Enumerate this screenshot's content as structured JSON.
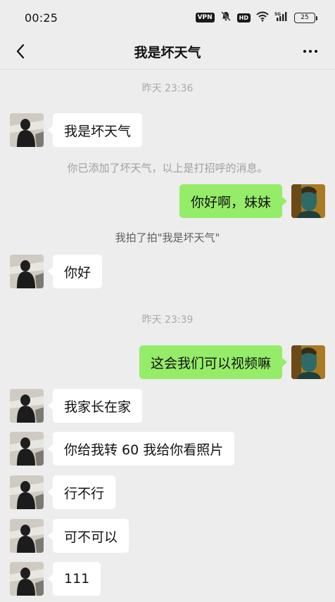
{
  "status_bar": {
    "time": "00:25",
    "vpn": "VPN",
    "hd": "HD",
    "battery": "25"
  },
  "nav": {
    "title": "我是坏天气"
  },
  "messages": {
    "ts1": "昨天 23:36",
    "m1": "我是坏天气",
    "sys1": "你已添加了坏天气，以上是打招呼的消息。",
    "m2": "你好啊，妹妹",
    "sys2": "我拍了拍\"我是坏天气\"",
    "m3": "你好",
    "ts2": "昨天 23:39",
    "m4": "这会我们可以视频嘛",
    "m5": "我家长在家",
    "m6": "你给我转 60 我给你看照片",
    "m7": "行不行",
    "m8": "可不可以",
    "m9": "111"
  },
  "colors": {
    "background": "#ededed",
    "sent_bubble": "#95ec69",
    "received_bubble": "#ffffff"
  }
}
